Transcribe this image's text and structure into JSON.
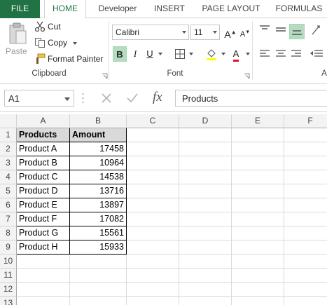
{
  "tabs": {
    "file": "FILE",
    "home": "HOME",
    "developer": "Developer",
    "insert": "INSERT",
    "page_layout": "PAGE LAYOUT",
    "formulas": "FORMULAS"
  },
  "clipboard": {
    "paste": "Paste",
    "cut": "Cut",
    "copy": "Copy",
    "format_painter": "Format Painter",
    "group_label": "Clipboard"
  },
  "font": {
    "family": "Calibri",
    "size": "11",
    "group_label": "Font",
    "bold": "B",
    "italic": "I",
    "underline": "U",
    "font_color": "#e81123",
    "fill_color": "#ffff00"
  },
  "alignment": {
    "group_label_fragment": "A"
  },
  "formula_bar": {
    "name_box": "A1",
    "fx": "fx",
    "content": "Products"
  },
  "sheet": {
    "columns": [
      "A",
      "B",
      "C",
      "D",
      "E",
      "F"
    ],
    "rows": [
      "1",
      "2",
      "3",
      "4",
      "5",
      "6",
      "7",
      "8",
      "9",
      "10",
      "11",
      "12",
      "13"
    ],
    "header": {
      "products": "Products",
      "amount": "Amount"
    },
    "data": [
      {
        "product": "Product A",
        "amount": "17458"
      },
      {
        "product": "Product B",
        "amount": "10964"
      },
      {
        "product": "Product C",
        "amount": "14538"
      },
      {
        "product": "Product D",
        "amount": "13716"
      },
      {
        "product": "Product E",
        "amount": "13897"
      },
      {
        "product": "Product F",
        "amount": "17082"
      },
      {
        "product": "Product G",
        "amount": "15561"
      },
      {
        "product": "Product H",
        "amount": "15933"
      }
    ]
  }
}
